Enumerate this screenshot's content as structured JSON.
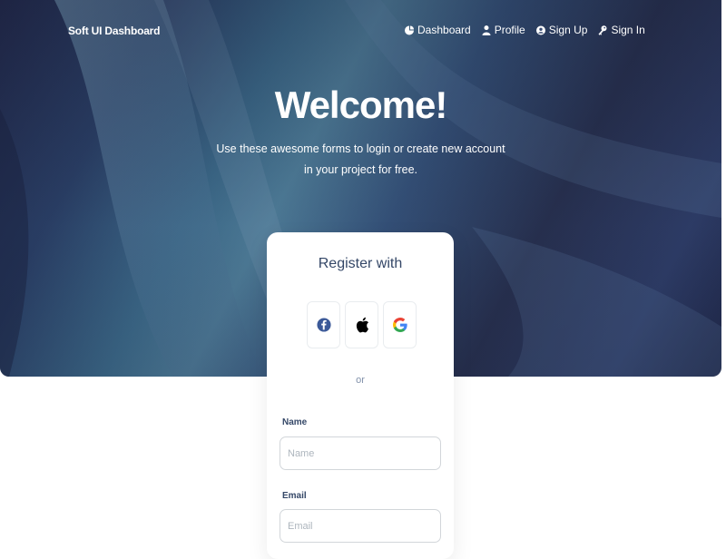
{
  "brand": "Soft UI Dashboard",
  "nav": [
    {
      "label": "Dashboard",
      "icon": "pie-chart-icon"
    },
    {
      "label": "Profile",
      "icon": "person-icon"
    },
    {
      "label": "Sign Up",
      "icon": "user-circle-icon"
    },
    {
      "label": "Sign In",
      "icon": "key-icon"
    }
  ],
  "hero": {
    "title": "Welcome!",
    "subtitle_line1": "Use these awesome forms to login or create new account",
    "subtitle_line2": "in your project for free."
  },
  "register": {
    "title": "Register with",
    "social": [
      "facebook-icon",
      "apple-icon",
      "google-icon"
    ],
    "divider": "or",
    "name_label": "Name",
    "name_placeholder": "Name",
    "email_label": "Email",
    "email_placeholder": "Email"
  },
  "colors": {
    "heading": "#344767",
    "muted": "#8392ab",
    "facebook": "#3b5998",
    "input_border": "#d2d6da"
  }
}
